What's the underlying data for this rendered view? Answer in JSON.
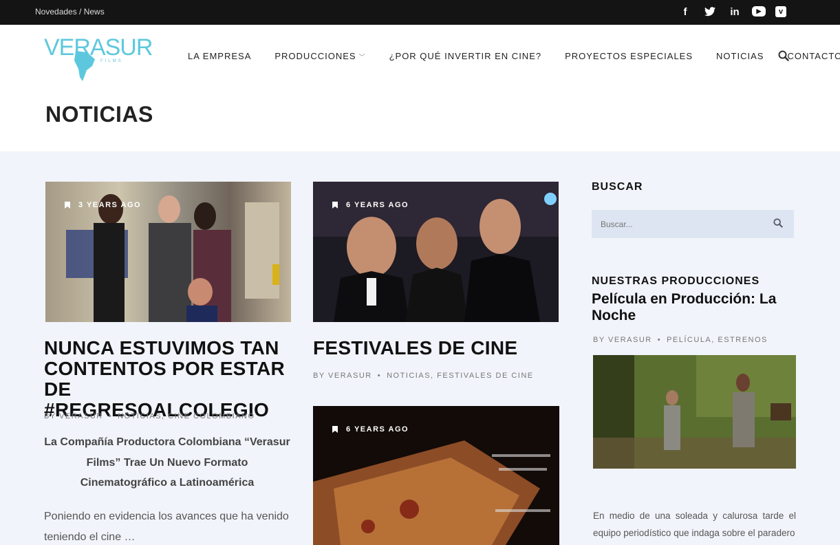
{
  "topbar": {
    "breadcrumb": "Novedades / News",
    "social": [
      {
        "icon": "facebook-icon",
        "glyph": "f"
      },
      {
        "icon": "twitter-icon",
        "glyph": "t"
      },
      {
        "icon": "linkedin-icon",
        "glyph": "in"
      },
      {
        "icon": "youtube-icon",
        "glyph": "▶"
      },
      {
        "icon": "vimeo-icon",
        "glyph": "v"
      }
    ]
  },
  "header": {
    "logo_text": "VERASUR",
    "logo_sub": "FILMS",
    "nav": {
      "empresa": "LA EMPRESA",
      "producciones": "PRODUCCIONES",
      "invertir": "¿POR QUÉ INVERTIR EN CINE?",
      "proyectos": "PROYECTOS ESPECIALES",
      "noticias": "NOTICIAS",
      "contacto": "CONTACTO"
    },
    "page_title": "NOTICIAS"
  },
  "posts": [
    {
      "age": "3 YEARS AGO",
      "title": "NUNCA ESTUVIMOS TAN CONTENTOS POR ESTAR DE #REGRESOALCOLEGIO",
      "author": "BY VERASUR",
      "categories": "NOTICIAS, CINE COLOMBIANO",
      "excerpt_bold": "La Compañía Productora Colombiana “Verasur Films” Trae Un Nuevo Formato Cinematográfico a Latinoamérica",
      "excerpt": "Poniendo en evidencia los avances que ha venido teniendo el cine …"
    },
    {
      "age": "6 YEARS AGO",
      "title": "FESTIVALES DE CINE",
      "author": "BY VERASUR",
      "categories": "NOTICIAS, FESTIVALES DE CINE"
    },
    {
      "age": "6 YEARS AGO"
    }
  ],
  "sidebar": {
    "search_heading": "BUSCAR",
    "search_placeholder": "Buscar...",
    "producciones_heading": "NUESTRAS PRODUCCIONES",
    "prod_title": "Película en Producción: La Noche",
    "prod_author": "BY VERASUR",
    "prod_categories": "PELÍCULA, ESTRENOS",
    "prod_text": "En medio de una soleada y calurosa tarde el equipo periodístico que indaga sobre el paradero"
  },
  "colors": {
    "accent": "#5dc8dd",
    "topbar": "#141414",
    "background": "#f1f4fa"
  }
}
